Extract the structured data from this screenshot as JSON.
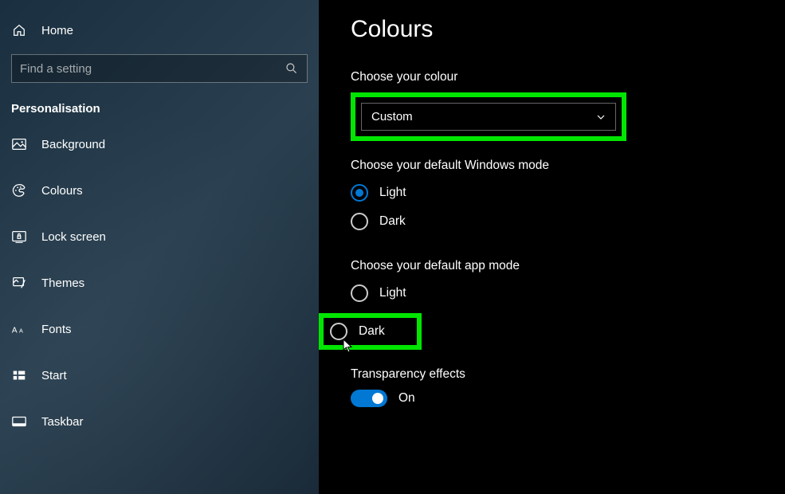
{
  "sidebar": {
    "home": "Home",
    "search_placeholder": "Find a setting",
    "section": "Personalisation",
    "items": [
      {
        "icon": "background-icon",
        "label": "Background"
      },
      {
        "icon": "colours-icon",
        "label": "Colours"
      },
      {
        "icon": "lockscreen-icon",
        "label": "Lock screen"
      },
      {
        "icon": "themes-icon",
        "label": "Themes"
      },
      {
        "icon": "fonts-icon",
        "label": "Fonts"
      },
      {
        "icon": "start-icon",
        "label": "Start"
      },
      {
        "icon": "taskbar-icon",
        "label": "Taskbar"
      }
    ]
  },
  "main": {
    "title": "Colours",
    "choose_colour_label": "Choose your colour",
    "choose_colour_value": "Custom",
    "windows_mode_label": "Choose your default Windows mode",
    "windows_mode_options": {
      "light": "Light",
      "dark": "Dark"
    },
    "windows_mode_selected": "light",
    "app_mode_label": "Choose your default app mode",
    "app_mode_options": {
      "light": "Light",
      "dark": "Dark"
    },
    "app_mode_selected": "",
    "transparency_label": "Transparency effects",
    "transparency_value": "On"
  },
  "colors": {
    "highlight": "#00e600",
    "accent": "#0078d4"
  }
}
